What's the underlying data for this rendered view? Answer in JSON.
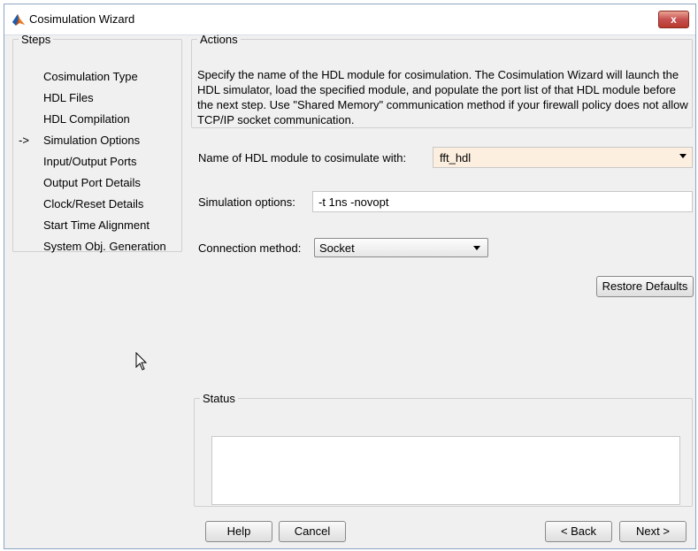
{
  "window": {
    "title": "Cosimulation Wizard",
    "close_label": "x"
  },
  "steps": {
    "legend": "Steps",
    "current_marker": "->",
    "items": [
      {
        "label": "Cosimulation Type",
        "current": false
      },
      {
        "label": "HDL Files",
        "current": false
      },
      {
        "label": "HDL Compilation",
        "current": false
      },
      {
        "label": "Simulation Options",
        "current": true
      },
      {
        "label": "Input/Output Ports",
        "current": false
      },
      {
        "label": "Output Port Details",
        "current": false
      },
      {
        "label": "Clock/Reset Details",
        "current": false
      },
      {
        "label": "Start Time Alignment",
        "current": false
      },
      {
        "label": "System Obj. Generation",
        "current": false
      }
    ]
  },
  "actions": {
    "legend": "Actions",
    "text": "Specify the name of the HDL module for cosimulation. The Cosimulation Wizard will launch the HDL simulator, load the specified module, and populate the port list of that HDL module before the next step. Use \"Shared Memory\" communication method if your firewall policy does not allow  TCP/IP socket communication."
  },
  "form": {
    "module_label": "Name of HDL module to cosimulate with:",
    "module_value": "fft_hdl",
    "sim_options_label": "Simulation options:",
    "sim_options_value": "-t 1ns -novopt",
    "connection_label": "Connection method:",
    "connection_value": "Socket",
    "restore_defaults": "Restore Defaults"
  },
  "status": {
    "legend": "Status",
    "text": ""
  },
  "buttons": {
    "help": "Help",
    "cancel": "Cancel",
    "back": "< Back",
    "next": "Next >"
  },
  "icons": {
    "app": "matlab-icon",
    "close": "close-icon",
    "cursor": "mouse-cursor-icon"
  }
}
